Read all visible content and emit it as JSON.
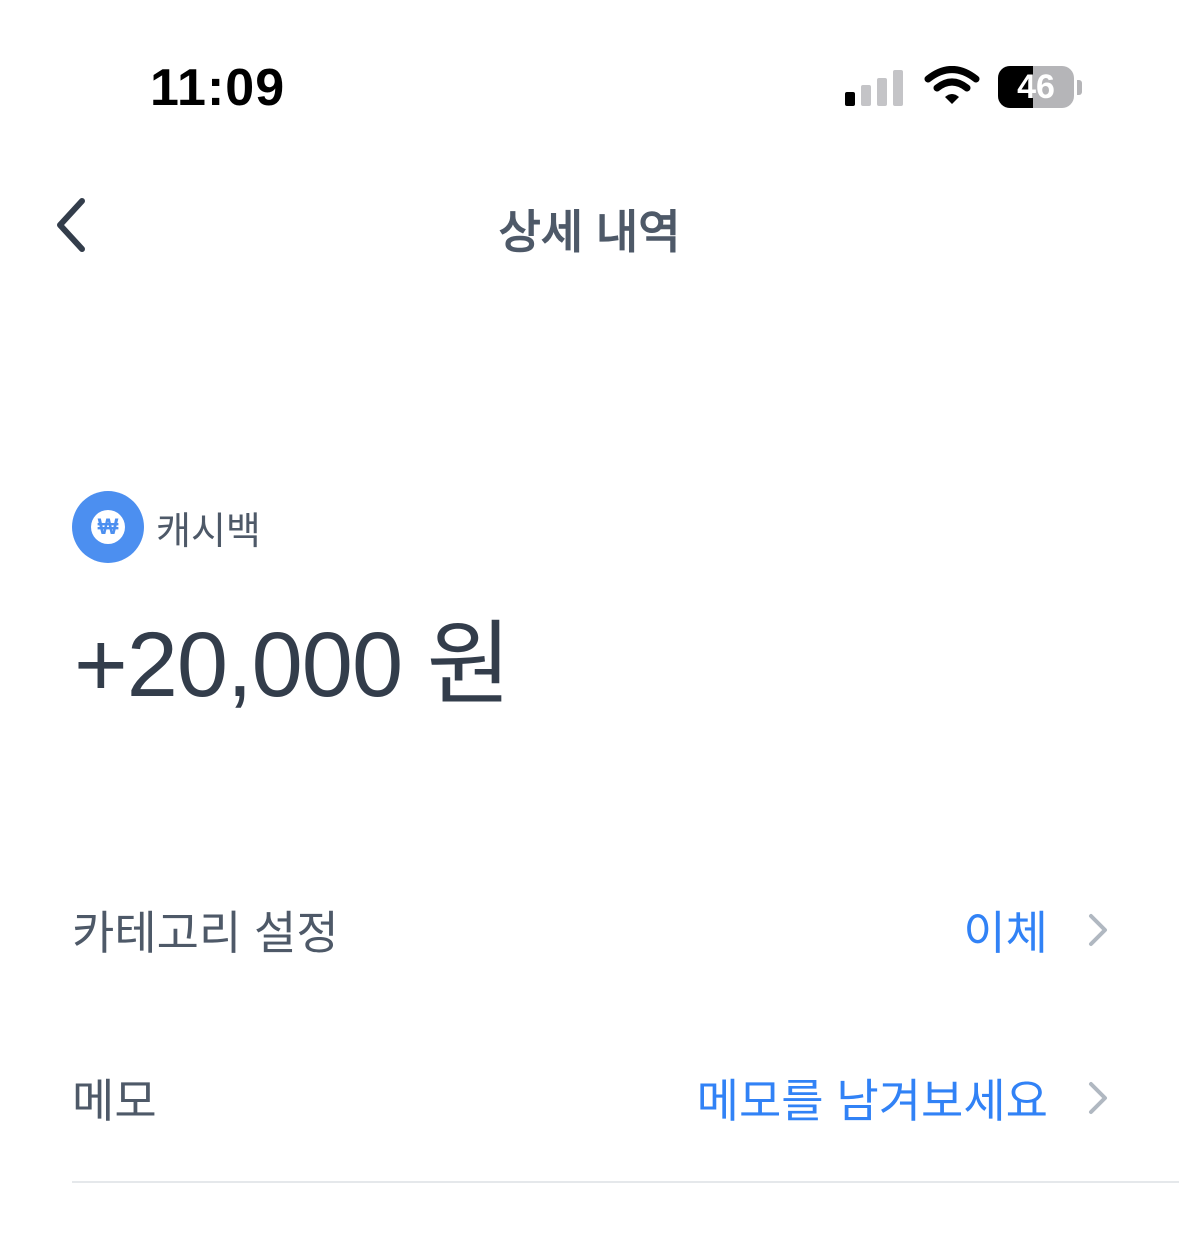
{
  "status_bar": {
    "time": "11:09",
    "battery_percent": "46",
    "battery_level": 0.46,
    "signal_bars_active": 1,
    "icons": [
      "signal-icon",
      "wifi-icon",
      "battery-icon"
    ]
  },
  "header": {
    "back_icon": "chevron-left-icon",
    "title": "상세 내역"
  },
  "transaction": {
    "type_icon": "won-icon",
    "type_icon_glyph": "₩",
    "type_label": "캐시백",
    "amount": "+20,000 원"
  },
  "details": {
    "category": {
      "label": "카테고리 설정",
      "value": "이체",
      "icon": "chevron-right-icon"
    },
    "memo": {
      "label": "메모",
      "value": "메모를 남겨보세요",
      "icon": "chevron-right-icon"
    }
  },
  "colors": {
    "accent": "#3182f6",
    "badge": "#4c8ff0",
    "text_primary": "#333d4b",
    "text_secondary": "#4e5968",
    "chevron": "#b0b8c1",
    "divider": "#e5e8eb"
  }
}
